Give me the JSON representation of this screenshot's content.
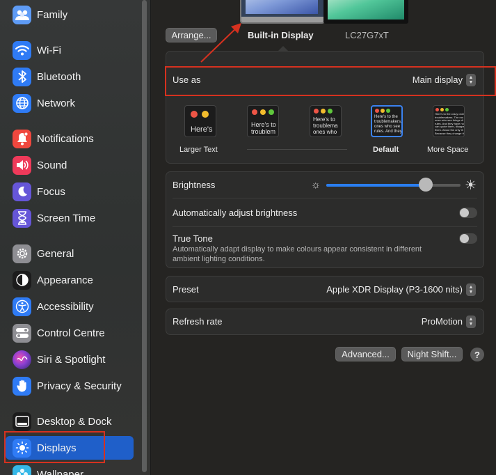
{
  "sidebar": {
    "items": [
      {
        "label": "Family",
        "icon": "family-icon",
        "color": "#5e9bf5"
      },
      {
        "label": "Wi-Fi",
        "icon": "wifi-icon",
        "color": "#2f7bf5"
      },
      {
        "label": "Bluetooth",
        "icon": "bluetooth-icon",
        "color": "#2f7bf5"
      },
      {
        "label": "Network",
        "icon": "globe-icon",
        "color": "#2f7bf5"
      },
      {
        "label": "Notifications",
        "icon": "bell-icon",
        "color": "#f0473e"
      },
      {
        "label": "Sound",
        "icon": "speaker-icon",
        "color": "#ef3a5a"
      },
      {
        "label": "Focus",
        "icon": "moon-icon",
        "color": "#6656d8"
      },
      {
        "label": "Screen Time",
        "icon": "hourglass-icon",
        "color": "#6656d8"
      },
      {
        "label": "General",
        "icon": "gear-icon",
        "color": "#8e8e93"
      },
      {
        "label": "Appearance",
        "icon": "appearance-icon",
        "color": "#1c1c1c"
      },
      {
        "label": "Accessibility",
        "icon": "accessibility-icon",
        "color": "#2f7bf5"
      },
      {
        "label": "Control Centre",
        "icon": "control-centre-icon",
        "color": "#8e8e93"
      },
      {
        "label": "Siri & Spotlight",
        "icon": "siri-icon",
        "color": "#8a3fd1"
      },
      {
        "label": "Privacy & Security",
        "icon": "hand-icon",
        "color": "#2f7bf5"
      },
      {
        "label": "Desktop & Dock",
        "icon": "dock-icon",
        "color": "#1c1c1c"
      },
      {
        "label": "Displays",
        "icon": "sun-icon",
        "color": "#2f7bf5"
      },
      {
        "label": "Wallpaper",
        "icon": "wallpaper-icon",
        "color": "#35b8e8"
      }
    ],
    "selected": "Displays"
  },
  "arrange": {
    "label": "Arrange..."
  },
  "displays": {
    "builtin": "Built-in Display",
    "external": "LC27G7xT"
  },
  "use_as": {
    "label": "Use as",
    "value": "Main display"
  },
  "resolution": {
    "options": [
      {
        "label": "Larger Text",
        "preview": "Here's"
      },
      {
        "label": "",
        "preview": "Here's to\ntroublem"
      },
      {
        "label": "",
        "preview": "Here's to\ntroublema\nones who"
      },
      {
        "label": "Default",
        "preview": "Here's to the\ntroublemakers,\nones who see t\nrules. And they"
      },
      {
        "label": "More Space",
        "preview": "Here's to the crazy ones\ntroublemakers. The rou\nones who see things di\nrules. And they have no\ncan quote them, disagre\nthem. About the only th\nBecause they change th"
      }
    ],
    "selected": "Default"
  },
  "brightness": {
    "label": "Brightness",
    "level": 0.74
  },
  "auto_brightness": {
    "label": "Automatically adjust brightness",
    "on": false
  },
  "true_tone": {
    "label": "True Tone",
    "description": "Automatically adapt display to make colours appear consistent in different ambient lighting conditions.",
    "on": false
  },
  "preset": {
    "label": "Preset",
    "value": "Apple XDR Display (P3-1600 nits)"
  },
  "refresh_rate": {
    "label": "Refresh rate",
    "value": "ProMotion"
  },
  "buttons": {
    "advanced": "Advanced...",
    "night_shift": "Night Shift...",
    "help": "?"
  },
  "colors": {
    "accent": "#1f5fc9",
    "highlight": "#d6311f",
    "slider": "#2a7ef0"
  }
}
